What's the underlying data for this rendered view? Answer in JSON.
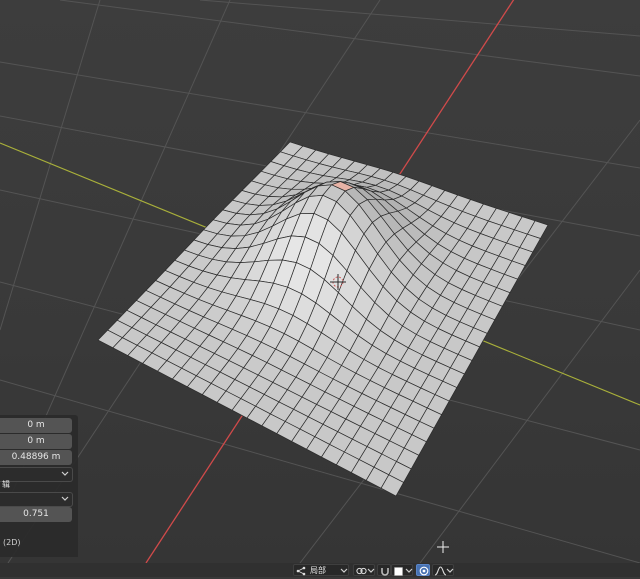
{
  "app": "Blender 3D viewport — proportional editing",
  "redo_panel": {
    "move_x": "0 m",
    "move_y": "0 m",
    "move_z": "0.48896 m",
    "orientation_value": "",
    "proportional_label": "辑",
    "falloff_value": "",
    "proportional_size": "0.751",
    "hint": "(2D)"
  },
  "header": {
    "pivot_label": "局部",
    "icons": [
      "transform-pivot-icon",
      "snap-link-icon",
      "magnet-icon",
      "snap-target-icon",
      "proportional-edit-icon",
      "falloff-curve-icon"
    ]
  },
  "colors": {
    "x_axis": "#d04a4a",
    "y_axis": "#a9b03a",
    "grid": "#545454",
    "mesh_face": "#c9c9c9",
    "selected_face": "#e7b3a6",
    "accent": "#4772b3"
  }
}
